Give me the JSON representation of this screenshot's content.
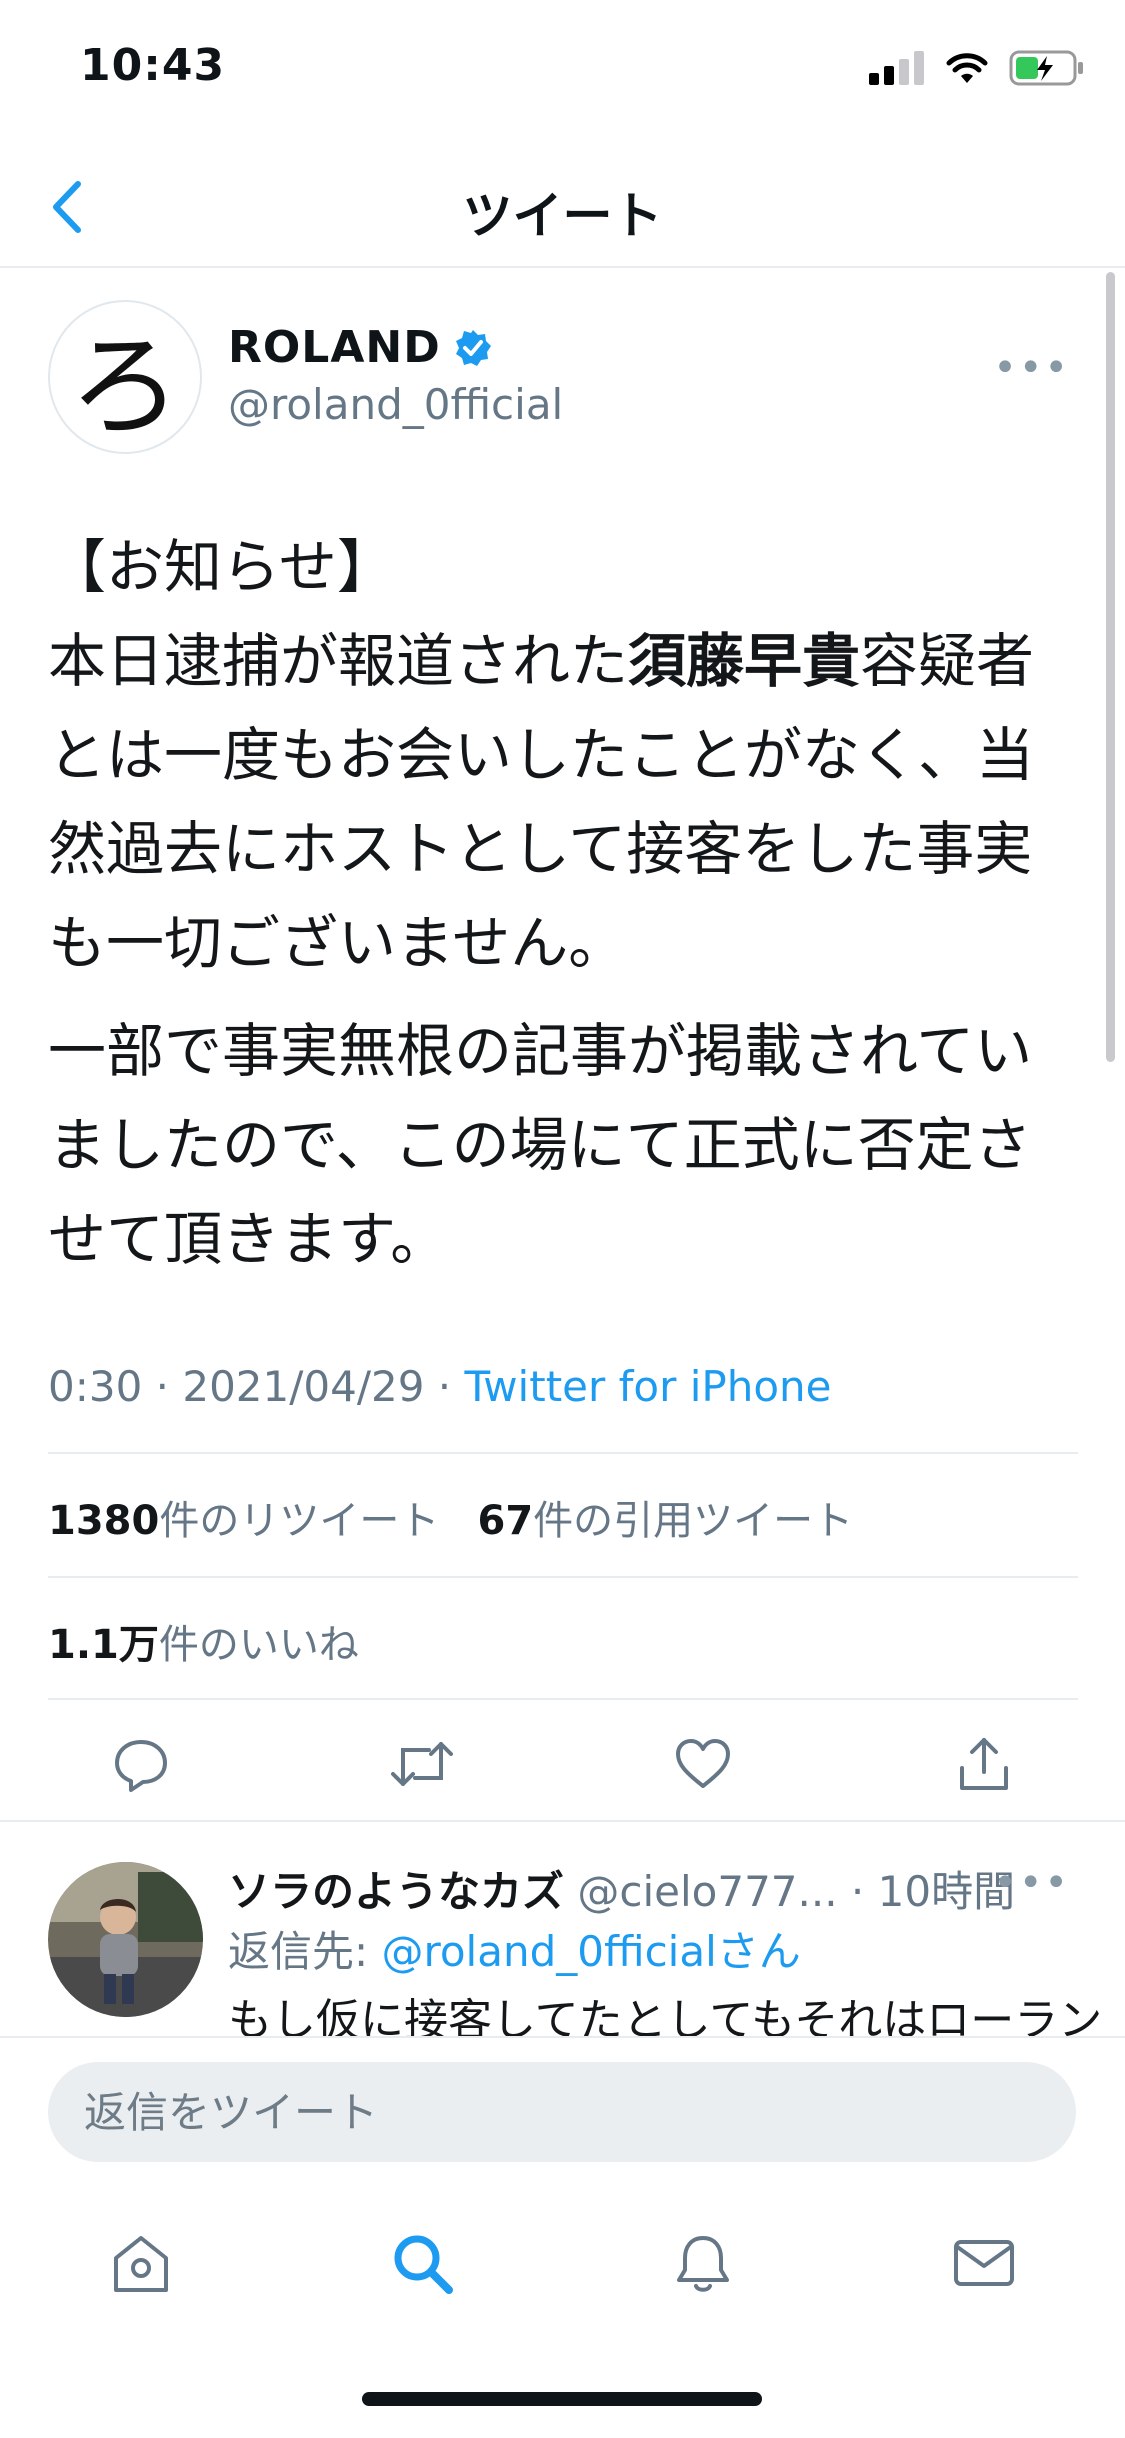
{
  "status_bar": {
    "time": "10:43"
  },
  "nav": {
    "title": "ツイート"
  },
  "tweet": {
    "author_name": "ROLAND",
    "handle": "@roland_0fficial",
    "avatar_glyph": "ろ",
    "paragraph1": {
      "line1": "【お知らせ】",
      "prefix": "本日逮捕が報道された",
      "bold": "須藤早貴",
      "suffix": "容疑者とは一度もお会いしたことがなく、当然過去にホストとして接客をした事実も一切ございません。"
    },
    "paragraph2": "一部で事実無根の記事が掲載されていましたので、この場にて正式に否定させて頂きます。",
    "timestamp": "0:30 · 2021/04/29 · ",
    "source": "Twitter for iPhone",
    "retweets_count": "1380",
    "retweets_label": "件のリツイート",
    "quotes_count": "67",
    "quotes_label": "件の引用ツイート",
    "likes_count": "1.1万",
    "likes_label": "件のいいね"
  },
  "reply": {
    "name": "ソラのようなカズ",
    "handle": "@cielo777...",
    "time": "· 10時間",
    "reply_to_prefix": "返信先: ",
    "reply_to_handle": "@roland_0fficial",
    "reply_to_suffix": "さん",
    "text": "もし仮に接客してたとしてもそれはローラン"
  },
  "composer": {
    "placeholder": "返信をツイート"
  },
  "colors": {
    "accent": "#1d9bf0",
    "verified": "#1d9bf0",
    "secondary_text": "#657786"
  }
}
